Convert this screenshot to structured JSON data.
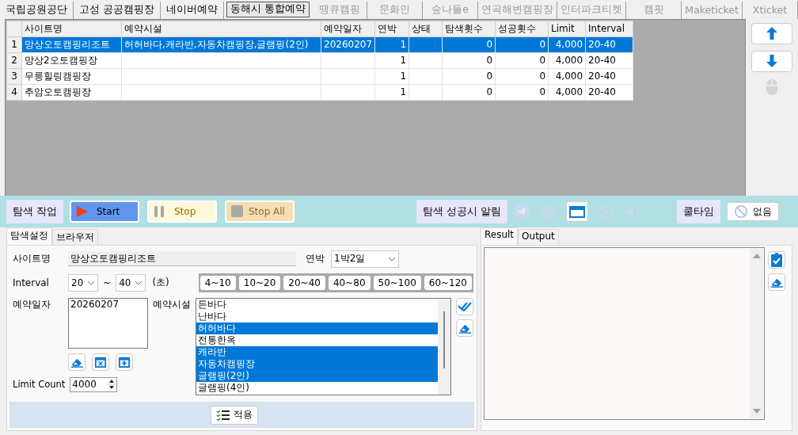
{
  "site_tabs": [
    {
      "label": "국립공원공단",
      "selected": false,
      "disabled": false
    },
    {
      "label": "고성 공공캠핑장",
      "selected": false,
      "disabled": false
    },
    {
      "label": "네이버예약",
      "selected": false,
      "disabled": false
    },
    {
      "label": "동해시 통합예약",
      "selected": true,
      "disabled": false
    },
    {
      "label": "땡큐캠핑",
      "selected": false,
      "disabled": true
    },
    {
      "label": "문화인",
      "selected": false,
      "disabled": true
    },
    {
      "label": "숲나들e",
      "selected": false,
      "disabled": true
    },
    {
      "label": "연곡해변캠핑장",
      "selected": false,
      "disabled": true
    },
    {
      "label": "인터파크티켓",
      "selected": false,
      "disabled": true
    },
    {
      "label": "캠핏",
      "selected": false,
      "disabled": true
    },
    {
      "label": "Maketicket",
      "selected": false,
      "disabled": true
    },
    {
      "label": "Xticket",
      "selected": false,
      "disabled": true
    }
  ],
  "grid": {
    "columns": [
      "사이트명",
      "예약시설",
      "예약일자",
      "연박",
      "상태",
      "탐색횟수",
      "성공횟수",
      "Limit",
      "Interval"
    ],
    "rows": [
      {
        "number": "1",
        "selected": true,
        "cells": [
          "망상오토캠핑리조트",
          "허허바다,캐라반,자동차캠핑장,글램핑(2인)",
          "20260207",
          "1",
          null,
          "0",
          "0",
          "4,000",
          "20-40"
        ]
      },
      {
        "number": "2",
        "selected": false,
        "cells": [
          "망상2오토캠핑장",
          null,
          null,
          "1",
          null,
          "0",
          "0",
          "4,000",
          "20-40"
        ]
      },
      {
        "number": "3",
        "selected": false,
        "cells": [
          "무릉힐링캠핑장",
          null,
          null,
          "1",
          null,
          "0",
          "0",
          "4,000",
          "20-40"
        ]
      },
      {
        "number": "4",
        "selected": false,
        "cells": [
          "추암오토캠핑장",
          null,
          null,
          "1",
          null,
          "0",
          "0",
          "4,000",
          "20-40"
        ]
      }
    ]
  },
  "side_buttons": [
    {
      "kind": "up",
      "disabled": false
    },
    {
      "kind": "down",
      "disabled": false
    },
    {
      "kind": "mouse",
      "disabled": true
    }
  ],
  "toolbar": {
    "task_label": "탐색 작업",
    "buttons": [
      {
        "kind": "start",
        "label": "Start"
      },
      {
        "kind": "stop",
        "label": "Stop"
      },
      {
        "kind": "stop_all",
        "label": "Stop All"
      }
    ],
    "notify_label": "탐색 성공시 알림",
    "notify_icons": [
      {
        "kind": "telegram",
        "disabled": true
      },
      {
        "kind": "slack",
        "disabled": true
      },
      {
        "kind": "window",
        "disabled": false
      },
      {
        "kind": "ban",
        "disabled": true
      },
      {
        "kind": "mute",
        "disabled": true
      }
    ],
    "cooltime_label": "쿨타임",
    "cooltime_button": "없음"
  },
  "settings": {
    "tabs": [
      {
        "label": "탐색설정",
        "selected": true
      },
      {
        "label": "브라우저",
        "selected": false
      }
    ],
    "site_label": "사이트명",
    "site_value": "망상오토캠핑리조트",
    "nights_label": "연박",
    "nights_value": "1박2일",
    "interval_label": "Interval",
    "interval_from": "20",
    "interval_sep": "~",
    "interval_to": "40",
    "interval_unit": "(초)",
    "presets": [
      "4~10",
      "10~20",
      "20~40",
      "40~80",
      "50~100",
      "60~120"
    ],
    "date_label": "예약일자",
    "dates": [
      "20260207"
    ],
    "facility_label": "예약시설",
    "facilities": [
      {
        "label": "든바다",
        "selected": false
      },
      {
        "label": "난바다",
        "selected": false
      },
      {
        "label": "허허바다",
        "selected": true
      },
      {
        "label": "전통한옥",
        "selected": false
      },
      {
        "label": "캐라반",
        "selected": true
      },
      {
        "label": "자동차캠핑장",
        "selected": true
      },
      {
        "label": "글램핑(2인)",
        "selected": true
      },
      {
        "label": "글램핑(4인)",
        "selected": false
      }
    ],
    "limit_label": "Limit Count",
    "limit_value": "4000",
    "apply_button": "적용"
  },
  "output": {
    "tabs": [
      {
        "label": "Result",
        "selected": true
      },
      {
        "label": "Output",
        "selected": false
      }
    ]
  }
}
